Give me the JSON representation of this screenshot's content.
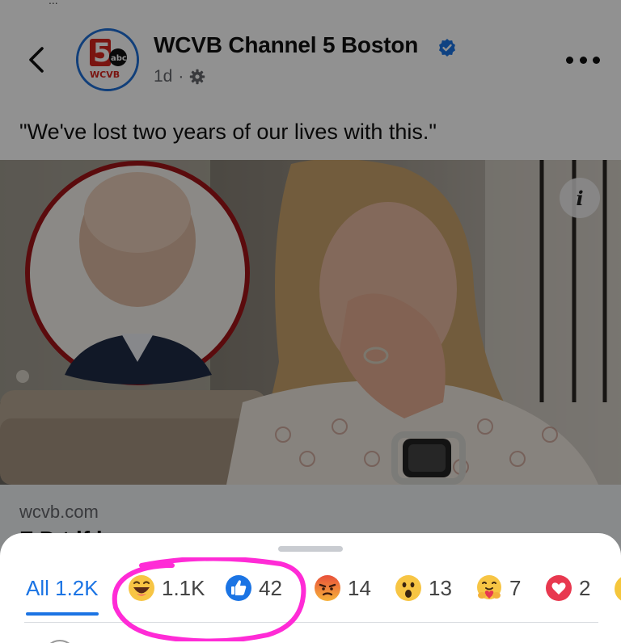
{
  "header": {
    "top_clipped_text": "...",
    "page_name": "WCVB Channel 5 Boston",
    "post_age": "1d",
    "meta_separator": "·"
  },
  "avatar": {
    "logo_number": "5",
    "logo_network": "abc",
    "logo_callsign": "WCVB"
  },
  "post": {
    "caption": "\"We've lost two years of our lives with this.\"",
    "info_label": "i"
  },
  "link_preview": {
    "domain": "wcvb.com",
    "title_partial": "F    D        t    lf    i"
  },
  "reactions_sheet": {
    "tabs": [
      {
        "id": "all",
        "label": "All 1.2K",
        "icon": "",
        "selected": true
      },
      {
        "id": "haha",
        "label": "1.1K",
        "icon": "haha-emoji-icon"
      },
      {
        "id": "like",
        "label": "42",
        "icon": "like-thumb-icon"
      },
      {
        "id": "angry",
        "label": "14",
        "icon": "angry-emoji-icon"
      },
      {
        "id": "wow",
        "label": "13",
        "icon": "wow-emoji-icon"
      },
      {
        "id": "care",
        "label": "7",
        "icon": "care-hug-emoji-icon"
      },
      {
        "id": "love",
        "label": "2",
        "icon": "love-heart-icon"
      }
    ]
  },
  "colors": {
    "accent_blue": "#1b74e4",
    "annotation_magenta": "#ff2bd6",
    "dim_overlay": "rgba(0,0,0,0.43)",
    "avatar_ring": "#1f6fd6"
  }
}
